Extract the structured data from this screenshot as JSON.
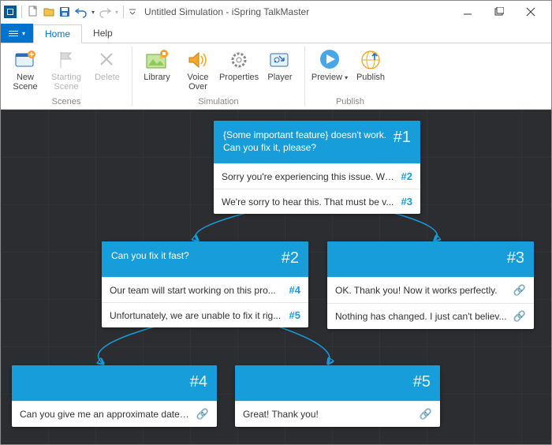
{
  "title": "Untitled Simulation - iSpring TalkMaster",
  "tabs": {
    "file_caret": "▾",
    "home": "Home",
    "help": "Help"
  },
  "ribbon": {
    "scenes_group": "Scenes",
    "simulation_group": "Simulation",
    "publish_group": "Publish",
    "new_scene": "New\nScene",
    "starting_scene": "Starting\nScene",
    "delete": "Delete",
    "library": "Library",
    "voice_over": "Voice\nOver",
    "properties": "Properties",
    "player": "Player",
    "preview": "Preview",
    "publish": "Publish"
  },
  "scenes": {
    "s1": {
      "num": "#1",
      "q": "{Some important feature} doesn't work. Can you fix it, please?",
      "r1": {
        "t": "Sorry you're experiencing this issue. We ...",
        "link": "#2"
      },
      "r2": {
        "t": "We're sorry to hear this. That must be v...",
        "link": "#3"
      }
    },
    "s2": {
      "num": "#2",
      "q": "Can you fix it fast?",
      "r1": {
        "t": "Our team will start working on this pro...",
        "link": "#4"
      },
      "r2": {
        "t": "Unfortunately, we are unable to fix it rig...",
        "link": "#5"
      }
    },
    "s3": {
      "num": "#3",
      "q": "",
      "r1": {
        "t": "OK. Thank you! Now it works perfectly."
      },
      "r2": {
        "t": "Nothing has changed. I just can't believ..."
      }
    },
    "s4": {
      "num": "#4",
      "q": "",
      "r1": {
        "t": "Can you give me an approximate date ..."
      }
    },
    "s5": {
      "num": "#5",
      "q": "",
      "r1": {
        "t": "Great! Thank you!"
      }
    }
  }
}
